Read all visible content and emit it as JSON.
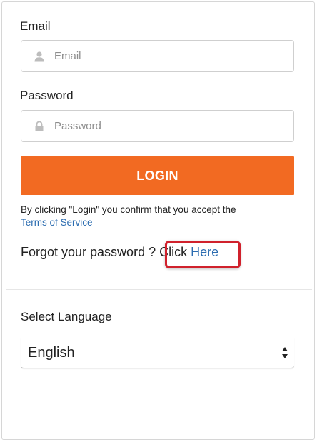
{
  "email": {
    "label": "Email",
    "placeholder": "Email",
    "icon": "user-icon"
  },
  "password": {
    "label": "Password",
    "placeholder": "Password",
    "icon": "lock-icon"
  },
  "login": {
    "label": "LOGIN",
    "color": "#f26a22"
  },
  "terms": {
    "text": "By clicking \"Login\" you confirm that you accept the",
    "link": "Terms of Service"
  },
  "forgot": {
    "text": "Forgot your password ?",
    "click": "Click",
    "link": "Here",
    "highlight_color": "#d0212c"
  },
  "language": {
    "label": "Select Language",
    "selected": "English"
  }
}
